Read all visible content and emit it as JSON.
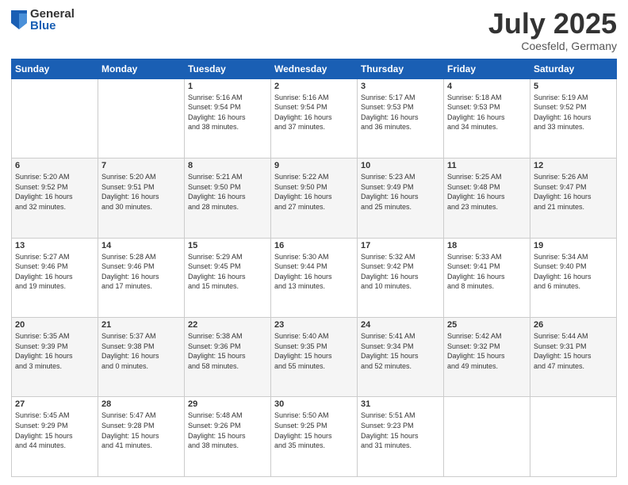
{
  "logo": {
    "general": "General",
    "blue": "Blue"
  },
  "title": "July 2025",
  "subtitle": "Coesfeld, Germany",
  "days": [
    "Sunday",
    "Monday",
    "Tuesday",
    "Wednesday",
    "Thursday",
    "Friday",
    "Saturday"
  ],
  "weeks": [
    [
      {
        "day": "",
        "content": ""
      },
      {
        "day": "",
        "content": ""
      },
      {
        "day": "1",
        "content": "Sunrise: 5:16 AM\nSunset: 9:54 PM\nDaylight: 16 hours\nand 38 minutes."
      },
      {
        "day": "2",
        "content": "Sunrise: 5:16 AM\nSunset: 9:54 PM\nDaylight: 16 hours\nand 37 minutes."
      },
      {
        "day": "3",
        "content": "Sunrise: 5:17 AM\nSunset: 9:53 PM\nDaylight: 16 hours\nand 36 minutes."
      },
      {
        "day": "4",
        "content": "Sunrise: 5:18 AM\nSunset: 9:53 PM\nDaylight: 16 hours\nand 34 minutes."
      },
      {
        "day": "5",
        "content": "Sunrise: 5:19 AM\nSunset: 9:52 PM\nDaylight: 16 hours\nand 33 minutes."
      }
    ],
    [
      {
        "day": "6",
        "content": "Sunrise: 5:20 AM\nSunset: 9:52 PM\nDaylight: 16 hours\nand 32 minutes."
      },
      {
        "day": "7",
        "content": "Sunrise: 5:20 AM\nSunset: 9:51 PM\nDaylight: 16 hours\nand 30 minutes."
      },
      {
        "day": "8",
        "content": "Sunrise: 5:21 AM\nSunset: 9:50 PM\nDaylight: 16 hours\nand 28 minutes."
      },
      {
        "day": "9",
        "content": "Sunrise: 5:22 AM\nSunset: 9:50 PM\nDaylight: 16 hours\nand 27 minutes."
      },
      {
        "day": "10",
        "content": "Sunrise: 5:23 AM\nSunset: 9:49 PM\nDaylight: 16 hours\nand 25 minutes."
      },
      {
        "day": "11",
        "content": "Sunrise: 5:25 AM\nSunset: 9:48 PM\nDaylight: 16 hours\nand 23 minutes."
      },
      {
        "day": "12",
        "content": "Sunrise: 5:26 AM\nSunset: 9:47 PM\nDaylight: 16 hours\nand 21 minutes."
      }
    ],
    [
      {
        "day": "13",
        "content": "Sunrise: 5:27 AM\nSunset: 9:46 PM\nDaylight: 16 hours\nand 19 minutes."
      },
      {
        "day": "14",
        "content": "Sunrise: 5:28 AM\nSunset: 9:46 PM\nDaylight: 16 hours\nand 17 minutes."
      },
      {
        "day": "15",
        "content": "Sunrise: 5:29 AM\nSunset: 9:45 PM\nDaylight: 16 hours\nand 15 minutes."
      },
      {
        "day": "16",
        "content": "Sunrise: 5:30 AM\nSunset: 9:44 PM\nDaylight: 16 hours\nand 13 minutes."
      },
      {
        "day": "17",
        "content": "Sunrise: 5:32 AM\nSunset: 9:42 PM\nDaylight: 16 hours\nand 10 minutes."
      },
      {
        "day": "18",
        "content": "Sunrise: 5:33 AM\nSunset: 9:41 PM\nDaylight: 16 hours\nand 8 minutes."
      },
      {
        "day": "19",
        "content": "Sunrise: 5:34 AM\nSunset: 9:40 PM\nDaylight: 16 hours\nand 6 minutes."
      }
    ],
    [
      {
        "day": "20",
        "content": "Sunrise: 5:35 AM\nSunset: 9:39 PM\nDaylight: 16 hours\nand 3 minutes."
      },
      {
        "day": "21",
        "content": "Sunrise: 5:37 AM\nSunset: 9:38 PM\nDaylight: 16 hours\nand 0 minutes."
      },
      {
        "day": "22",
        "content": "Sunrise: 5:38 AM\nSunset: 9:36 PM\nDaylight: 15 hours\nand 58 minutes."
      },
      {
        "day": "23",
        "content": "Sunrise: 5:40 AM\nSunset: 9:35 PM\nDaylight: 15 hours\nand 55 minutes."
      },
      {
        "day": "24",
        "content": "Sunrise: 5:41 AM\nSunset: 9:34 PM\nDaylight: 15 hours\nand 52 minutes."
      },
      {
        "day": "25",
        "content": "Sunrise: 5:42 AM\nSunset: 9:32 PM\nDaylight: 15 hours\nand 49 minutes."
      },
      {
        "day": "26",
        "content": "Sunrise: 5:44 AM\nSunset: 9:31 PM\nDaylight: 15 hours\nand 47 minutes."
      }
    ],
    [
      {
        "day": "27",
        "content": "Sunrise: 5:45 AM\nSunset: 9:29 PM\nDaylight: 15 hours\nand 44 minutes."
      },
      {
        "day": "28",
        "content": "Sunrise: 5:47 AM\nSunset: 9:28 PM\nDaylight: 15 hours\nand 41 minutes."
      },
      {
        "day": "29",
        "content": "Sunrise: 5:48 AM\nSunset: 9:26 PM\nDaylight: 15 hours\nand 38 minutes."
      },
      {
        "day": "30",
        "content": "Sunrise: 5:50 AM\nSunset: 9:25 PM\nDaylight: 15 hours\nand 35 minutes."
      },
      {
        "day": "31",
        "content": "Sunrise: 5:51 AM\nSunset: 9:23 PM\nDaylight: 15 hours\nand 31 minutes."
      },
      {
        "day": "",
        "content": ""
      },
      {
        "day": "",
        "content": ""
      }
    ]
  ]
}
